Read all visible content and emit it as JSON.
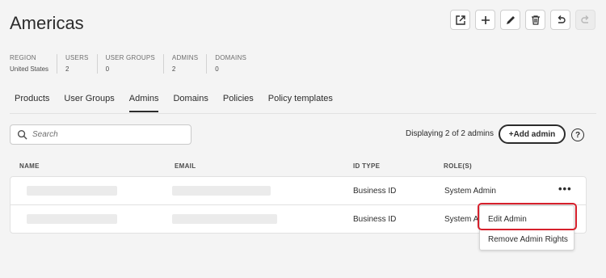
{
  "header": {
    "title": "Americas"
  },
  "toolbar": {
    "buttons": [
      {
        "icon": "external-link-icon"
      },
      {
        "icon": "plus-icon"
      },
      {
        "icon": "pencil-icon"
      },
      {
        "icon": "trash-icon"
      },
      {
        "icon": "undo-icon"
      },
      {
        "icon": "redo-icon",
        "disabled": true
      }
    ]
  },
  "stats": [
    {
      "label": "REGION",
      "value": "United States"
    },
    {
      "label": "USERS",
      "value": "2"
    },
    {
      "label": "USER GROUPS",
      "value": "0"
    },
    {
      "label": "ADMINS",
      "value": "2"
    },
    {
      "label": "DOMAINS",
      "value": "0"
    }
  ],
  "tabs": [
    {
      "label": "Products",
      "active": false
    },
    {
      "label": "User Groups",
      "active": false
    },
    {
      "label": "Admins",
      "active": true
    },
    {
      "label": "Domains",
      "active": false
    },
    {
      "label": "Policies",
      "active": false
    },
    {
      "label": "Policy templates",
      "active": false
    }
  ],
  "search": {
    "placeholder": "Search"
  },
  "summary": {
    "count_text": "Displaying 2 of 2 admins"
  },
  "actions": {
    "add_admin_label": "+Add admin",
    "help_label": "?"
  },
  "table": {
    "columns": [
      "NAME",
      "EMAIL",
      "ID TYPE",
      "ROLE(S)"
    ],
    "rows": [
      {
        "id_type": "Business ID",
        "role": "System Admin"
      },
      {
        "id_type": "Business ID",
        "role": "System A"
      }
    ],
    "more_label": "•••"
  },
  "context_menu": {
    "items": [
      "Edit Admin",
      "Remove Admin Rights"
    ]
  },
  "colors": {
    "highlight": "#d6202c",
    "text": "#2c2c2c"
  }
}
